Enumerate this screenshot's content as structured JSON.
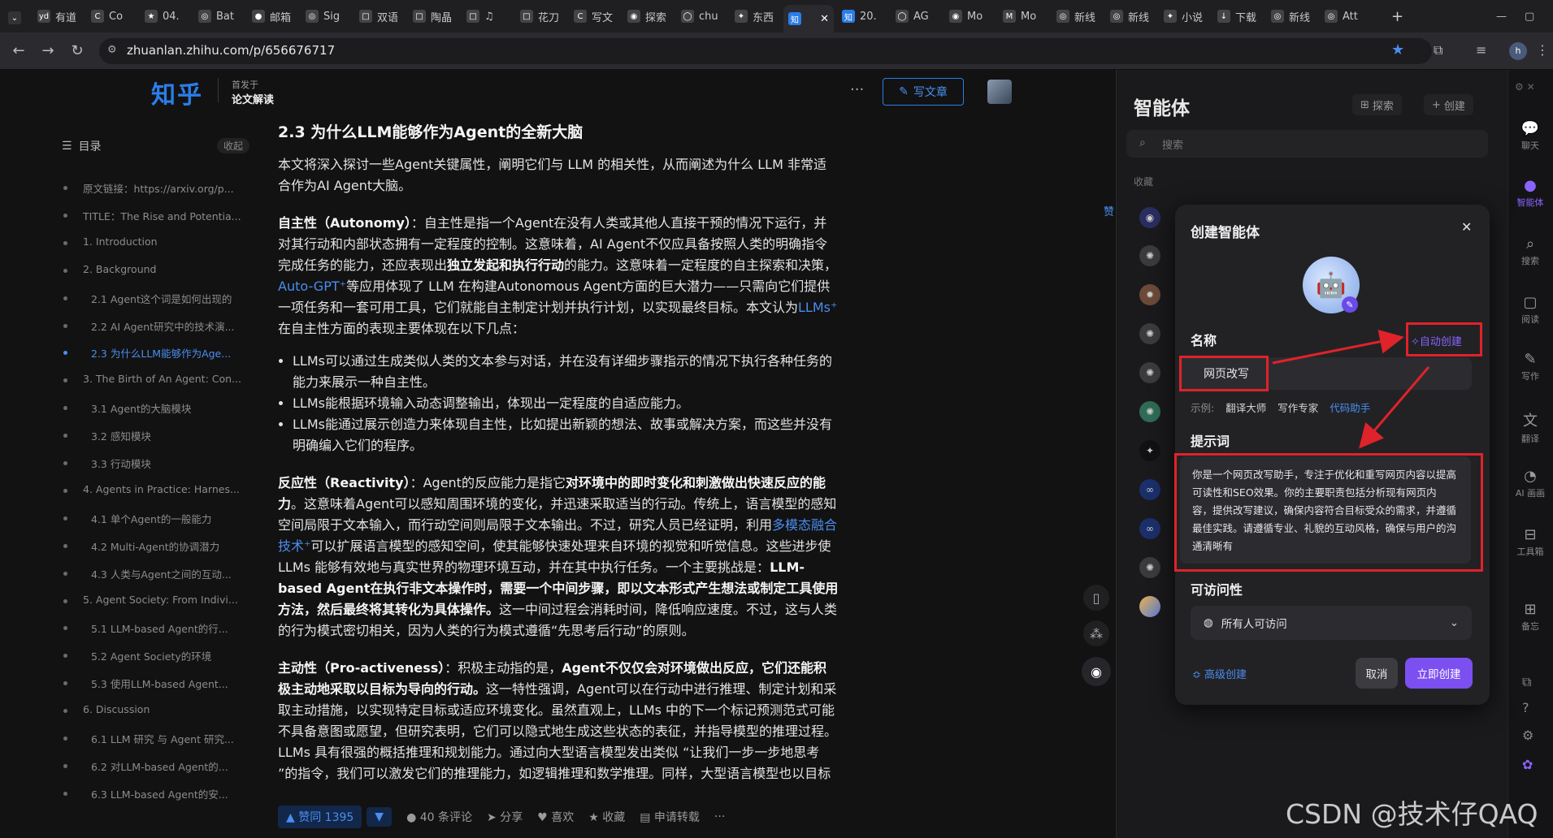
{
  "browser": {
    "tabs": [
      {
        "icon": "yd",
        "label": "有道"
      },
      {
        "icon": "C",
        "label": "Co"
      },
      {
        "icon": "★",
        "label": "04."
      },
      {
        "icon": "◎",
        "label": "Bat"
      },
      {
        "icon": "●",
        "label": "邮箱"
      },
      {
        "icon": "◎",
        "label": "Sig"
      },
      {
        "icon": "□",
        "label": "双语"
      },
      {
        "icon": "□",
        "label": "陶晶"
      },
      {
        "icon": "□",
        "label": "♫"
      },
      {
        "icon": "□",
        "label": "花刀"
      },
      {
        "icon": "C",
        "label": "写文"
      },
      {
        "icon": "◉",
        "label": "探索"
      },
      {
        "icon": "◯",
        "label": "chu"
      },
      {
        "icon": "✦",
        "label": "东西"
      },
      {
        "icon": "知",
        "label": ""
      },
      {
        "icon": "知",
        "label": "20."
      },
      {
        "icon": "◯",
        "label": "AG"
      },
      {
        "icon": "◉",
        "label": "Mo"
      },
      {
        "icon": "M",
        "label": "Mo"
      },
      {
        "icon": "◎",
        "label": "新线"
      },
      {
        "icon": "◎",
        "label": "新线"
      },
      {
        "icon": "✦",
        "label": "小说"
      },
      {
        "icon": "↓",
        "label": "下载"
      },
      {
        "icon": "◎",
        "label": "新线"
      },
      {
        "icon": "◎",
        "label": "Att"
      }
    ],
    "url": "zhuanlan.zhihu.com/p/656676717"
  },
  "zhihu": {
    "logo": "知乎",
    "pub_from": "首发于",
    "pub_column": "论文解读",
    "write_btn": "写文章",
    "toc_title": "目录",
    "toc_fold": "收起",
    "toc": [
      "原文链接：https://arxiv.org/p...",
      "TITLE：The Rise and Potentia...",
      "1. Introduction",
      "2. Background",
      "2.1 Agent这个词是如何出现的",
      "2.2 AI Agent研究中的技术演...",
      "2.3 为什么LLM能够作为Age...",
      "3. The Birth of An Agent: Con...",
      "3.1 Agent的大脑模块",
      "3.2 感知模块",
      "3.3 行动模块",
      "4. Agents in Practice: Harnes...",
      "4.1 单个Agent的一般能力",
      "4.2 Multi-Agent的协调潜力",
      "4.3 人类与Agent之间的互动...",
      "5. Agent Society: From Indivi...",
      "5.1 LLM-based Agent的行...",
      "5.2 Agent Society的环境",
      "5.3 使用LLM-based Agent...",
      "6. Discussion",
      "6.1 LLM 研究 与 Agent 研究...",
      "6.2 对LLM-based Agent的...",
      "6.3 LLM-based Agent的安..."
    ],
    "article": {
      "heading": "2.3 为什么LLM能够作为Agent的全新大脑",
      "intro": "本文将深入探讨一些Agent关键属性，阐明它们与 LLM 的相关性，从而阐述为什么 LLM 非常适合作为AI Agent大脑。",
      "p1_bold": "自主性（Autonomy）",
      "p1_a": "：自主性是指一个Agent在没有人类或其他人直接干预的情况下运行，并对其行动和内部状态拥有一定程度的控制。这意味着，AI Agent不仅应具备按照人类的明确指令完成任务的能力，还应表现出",
      "p1_bold2": "独立发起和执行行动",
      "p1_b": "的能力。这意味着一定程度的自主探索和决策，",
      "p1_link": "Auto-GPT",
      "p1_c": "等应用体现了 LLM 在构建Autonomous Agent方面的巨大潜力——只需向它们提供一项任务和一套可用工具，它们就能自主制定计划并执行计划，以实现最终目标。本文认为",
      "p1_link2": "LLMs",
      "p1_d": "在自主性方面的表现主要体现在以下几点：",
      "bullets": [
        "LLMs可以通过生成类似人类的文本参与对话，并在没有详细步骤指示的情况下执行各种任务的能力来展示一种自主性。",
        "LLMs能根据环境输入动态调整输出，体现出一定程度的自适应能力。",
        "LLMs能通过展示创造力来体现自主性，比如提出新颖的想法、故事或解决方案，而这些并没有明确编入它们的程序。"
      ],
      "p2_bold": "反应性（Reactivity）",
      "p2_a": "：Agent的反应能力是指它",
      "p2_bold2": "对环境中的即时变化和刺激做出快速反应的能力",
      "p2_b": "。这意味着Agent可以感知周围环境的变化，并迅速采取适当的行动。传统上，语言模型的感知空间局限于文本输入，而行动空间则局限于文本输出。不过，研究人员已经证明，利用",
      "p2_link": "多模态融合技术",
      "p2_c": "可以扩展语言模型的感知空间，使其能够快速处理来自环境的视觉和听觉信息。这些进步使 LLMs 能够有效地与真实世界的物理环境互动，并在其中执行任务。一个主要挑战是：",
      "p2_bold3": "LLM-based Agent在执行非文本操作时，需要一个中间步骤，即以文本形式产生想法或制定工具使用方法，然后最终将其转化为具体操作。",
      "p2_d": "这一中间过程会消耗时间，降低响应速度。不过，这与人类的行为模式密切相关，因为人类的行为模式遵循“先思考后行动”的原则。",
      "p3_bold": "主动性（Pro-activeness）",
      "p3_a": "：积极主动指的是，",
      "p3_bold2": "Agent不仅仅会对环境做出反应，它们还能积极主动地采取以目标为导向的行动。",
      "p3_b": "这一特性强调，Agent可以在行动中进行推理、制定计划和采取主动措施，以实现特定目标或适应环境变化。虽然直观上，LLMs 中的下一个标记预测范式可能不具备意图或愿望，但研究表明，它们可以隐式地生成这些状态的表征，并指导模型的推理过程。LLMs 具有很强的概括推理和规划能力。通过向大型语言模型发出类似 “让我们一步一步地思考 ”的指令，我们可以激发它们的推理能力，如逻辑推理和数学推理。同样，大型语言模型也以目标"
    },
    "actions": {
      "vote": "▲ 赞同 1395",
      "vote_down": "▼",
      "comments": "40 条评论",
      "share": "分享",
      "like": "喜欢",
      "collect": "收藏",
      "repost": "申请转载",
      "more": "···"
    }
  },
  "agent_panel": {
    "title": "智能体",
    "explore": "探索",
    "create": "创建",
    "search_placeholder": "搜索",
    "fav_label": "收藏"
  },
  "rail": [
    {
      "icon": "💬",
      "label": "聊天"
    },
    {
      "icon": "●",
      "label": "智能体"
    },
    {
      "icon": "⌕",
      "label": "搜索"
    },
    {
      "icon": "▢",
      "label": "阅读"
    },
    {
      "icon": "✎",
      "label": "写作"
    },
    {
      "icon": "文",
      "label": "翻译"
    },
    {
      "icon": "◔",
      "label": "AI 画画"
    },
    {
      "icon": "⊟",
      "label": "工具箱"
    },
    {
      "icon": "⊞",
      "label": "备忘"
    }
  ],
  "modal": {
    "title": "创建智能体",
    "close": "✕",
    "name_label": "名称",
    "auto_create": "自动创建",
    "name_value": "网页改写",
    "examples_label": "示例:",
    "examples": [
      "翻译大师",
      "写作专家",
      "代码助手"
    ],
    "prompt_label": "提示词",
    "prompt_value": "你是一个网页改写助手，专注于优化和重写网页内容以提高可读性和SEO效果。你的主要职责包括分析现有网页内容，提供改写建议，确保内容符合目标受众的需求，并遵循最佳实践。请遵循专业、礼貌的互动风格，确保与用户的沟通清晰有",
    "access_label": "可访问性",
    "access_value": "所有人可访问",
    "advanced": "高级创建",
    "cancel": "取消",
    "submit": "立即创建"
  },
  "side_label": "赞",
  "watermark": "CSDN @技术仔QAQ",
  "colors": {
    "accent": "#7b4ff0",
    "zhihu_blue": "#2b7de9",
    "annotation_red": "#e0222a"
  }
}
